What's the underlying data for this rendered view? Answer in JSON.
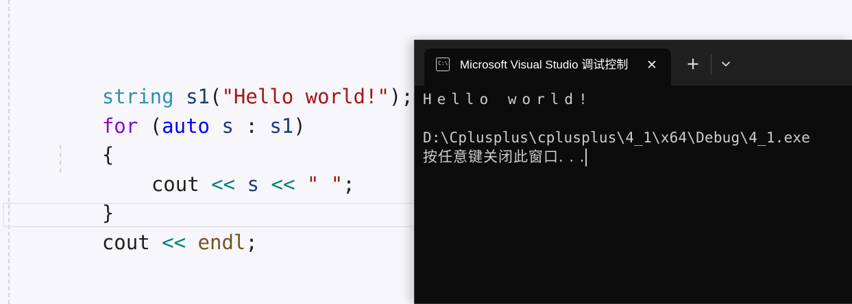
{
  "editor": {
    "lines": [
      {
        "tokens": [
          "string",
          " ",
          "s1",
          "(",
          "\"Hello world!\"",
          ");"
        ]
      },
      {
        "tokens": [
          "for",
          " (",
          "auto",
          " ",
          "s",
          " : ",
          "s1",
          ")"
        ]
      },
      {
        "tokens": [
          "{"
        ]
      },
      {
        "tokens": [
          "cout",
          " ",
          "<<",
          " ",
          "s",
          " ",
          "<<",
          " ",
          "\" \"",
          ";"
        ]
      },
      {
        "tokens": [
          "}"
        ]
      },
      {
        "tokens": [
          "cout",
          " ",
          "<<",
          " ",
          "endl",
          ";"
        ]
      }
    ]
  },
  "console": {
    "tab_title": "Microsoft Visual Studio 调试控制台",
    "icon_text": "C:\\",
    "close_glyph": "✕",
    "new_tab_glyph": "+",
    "output": {
      "line1": "Hello world!",
      "line2": "D:\\Cplusplus\\cplusplus\\4_1\\x64\\Debug\\4_1.exe",
      "line3": "按任意键关闭此窗口. . ."
    }
  },
  "colors": {
    "editor_bg": "#f7f7fb",
    "type_keyword": "#2b91af",
    "flow_keyword": "#8f08c4",
    "keyword": "#0000ff",
    "identifier": "#1f377f",
    "string": "#a31515",
    "operator": "#008080",
    "function": "#74531f",
    "console_bg": "#0c0c0c",
    "titlebar_bg": "#202020",
    "console_text": "#cccccc"
  },
  "icons": {
    "console_tab": "terminal-icon",
    "close": "close-icon",
    "new_tab": "plus-icon",
    "dropdown": "chevron-down-icon"
  }
}
